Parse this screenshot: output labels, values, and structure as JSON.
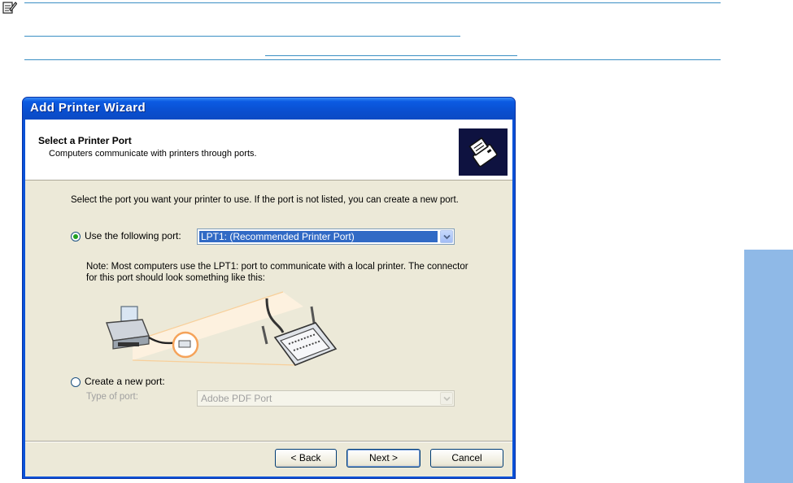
{
  "window": {
    "title": "Add Printer Wizard"
  },
  "header": {
    "title": "Select a Printer Port",
    "subtitle": "Computers communicate with printers through ports."
  },
  "body": {
    "intro": "Select the port you want your printer to use.  If the port is not listed, you can create a new port.",
    "use_port": {
      "label": "Use the following port:",
      "selected": true,
      "value": "LPT1: (Recommended Printer Port)"
    },
    "note": "Note: Most computers use the LPT1: port to communicate with a local printer. The connector for this port should look something like this:",
    "create_port": {
      "label": "Create a new port:",
      "selected": false,
      "type_label": "Type of port:",
      "type_value": "Adobe PDF Port"
    }
  },
  "buttons": {
    "back": "< Back",
    "next": "Next >",
    "cancel": "Cancel"
  },
  "colors": {
    "titlebar": "#0a52d8",
    "dialog_bg": "#ece9d8",
    "selection": "#316ac5",
    "side_tab": "#8fb9e7",
    "rule": "#3b8fc4"
  },
  "icons": [
    "note-icon",
    "printer-wizard-icon",
    "radio-icon",
    "chevron-down-icon",
    "printer-icon",
    "parallel-connector-icon"
  ]
}
